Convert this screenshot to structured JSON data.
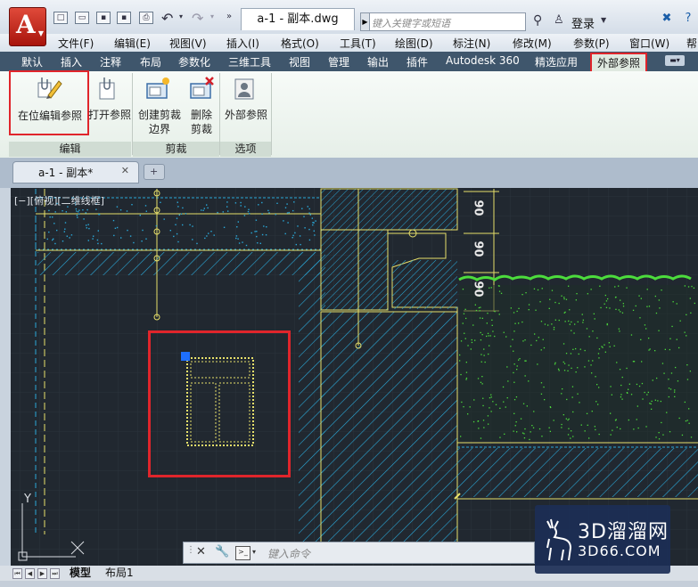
{
  "title_bar": {
    "document_tab": "a-1 - 副本.dwg",
    "search_placeholder": "键入关键字或短语",
    "login_label": "登录",
    "window_controls": [
      "close-icon",
      "help-icon"
    ]
  },
  "menu": [
    "文件(F)",
    "编辑(E)",
    "视图(V)",
    "插入(I)",
    "格式(O)",
    "工具(T)",
    "绘图(D)",
    "标注(N)",
    "修改(M)",
    "参数(P)",
    "窗口(W)",
    "帮"
  ],
  "ribbon_tabs": [
    "默认",
    "插入",
    "注释",
    "布局",
    "参数化",
    "三维工具",
    "视图",
    "管理",
    "输出",
    "插件",
    "Autodesk 360",
    "精选应用"
  ],
  "ribbon_active_tab": "外部参照",
  "ribbon": {
    "edit_panel": {
      "label": "编辑",
      "buttons": [
        "在位编辑参照",
        "打开参照"
      ]
    },
    "clip_panel": {
      "label": "剪裁",
      "buttons": [
        "创建剪裁\n边界",
        "删除\n剪裁"
      ]
    },
    "options_panel": {
      "label": "选项",
      "buttons": [
        "外部参照"
      ]
    }
  },
  "drawing_tab": {
    "label": "a-1 - 副本*"
  },
  "viewport_label": "[−][俯视][二维线框]",
  "dimensions": [
    "90",
    "90",
    "90"
  ],
  "command_line": {
    "placeholder": "键入命令"
  },
  "layout_tabs": [
    "模型",
    "布局1"
  ],
  "ucs": {
    "y_label": "Y",
    "x_label": "X"
  },
  "watermark": {
    "line1": "3D溜溜网",
    "line2": "3D66.COM"
  },
  "colors": {
    "canvas_bg": "#212830",
    "highlight_red": "#e0252b",
    "cad_yellow": "#e7e06a",
    "cad_cyan": "#2aa9d9",
    "grass_green": "#4cdc3c",
    "ribbon_tab_bar": "#3f566c"
  }
}
